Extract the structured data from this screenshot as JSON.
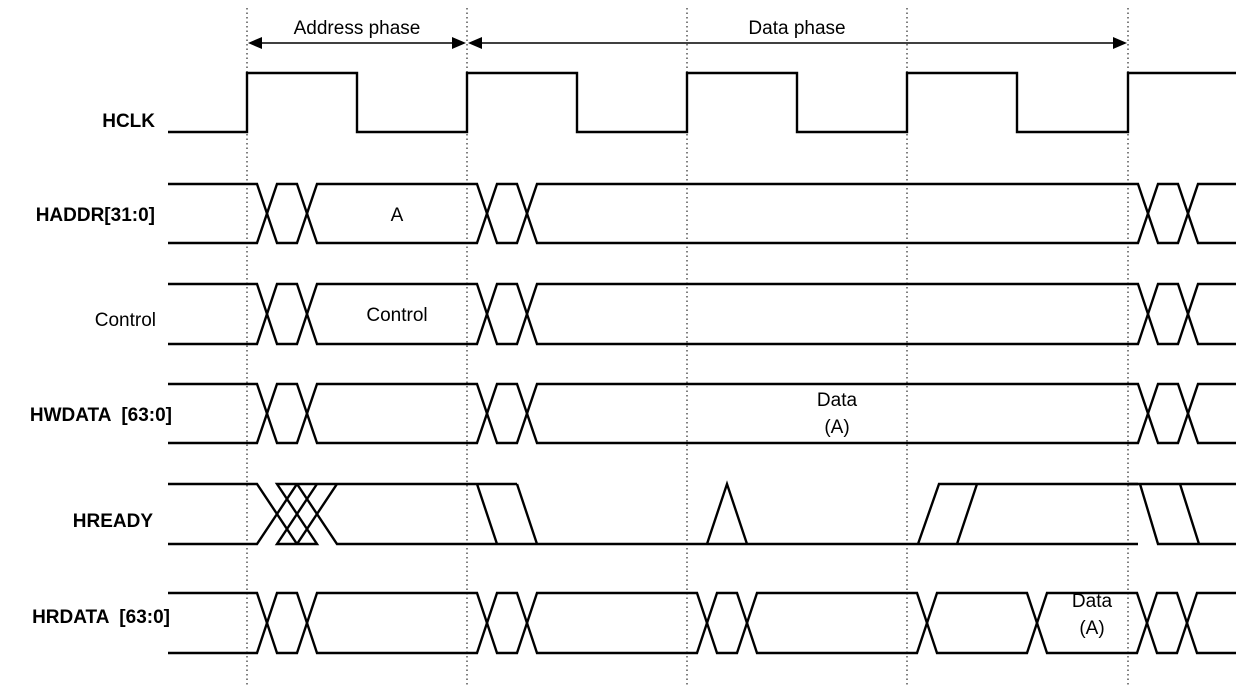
{
  "diagram": {
    "type": "timing-diagram",
    "title": "",
    "phases": [
      {
        "label": "Address phase",
        "from_cycle": 0,
        "to_cycle": 1
      },
      {
        "label": "Data phase",
        "from_cycle": 1,
        "to_cycle": 4
      }
    ],
    "clock_edges": 5,
    "signals": [
      {
        "name": "HCLK",
        "bold": true,
        "kind": "clock"
      },
      {
        "name": "HADDR[31:0]",
        "bold": true,
        "kind": "bus",
        "segments": [
          {
            "text": "A",
            "cycle": 0
          }
        ]
      },
      {
        "name": "Control",
        "bold": false,
        "kind": "bus",
        "segments": [
          {
            "text": "Control",
            "cycle": 0
          }
        ]
      },
      {
        "name": "HWDATA  [63:0]",
        "bold": true,
        "kind": "bus",
        "segments": [
          {
            "text": "Data",
            "text2": "(A)",
            "cycle": 1.7
          }
        ]
      },
      {
        "name": "HREADY",
        "bold": true,
        "kind": "ready"
      },
      {
        "name": "HRDATA  [63:0]",
        "bold": true,
        "kind": "bus",
        "segments": [
          {
            "text": "Data",
            "text2": "(A)",
            "cycle": 3.75
          }
        ]
      }
    ]
  }
}
